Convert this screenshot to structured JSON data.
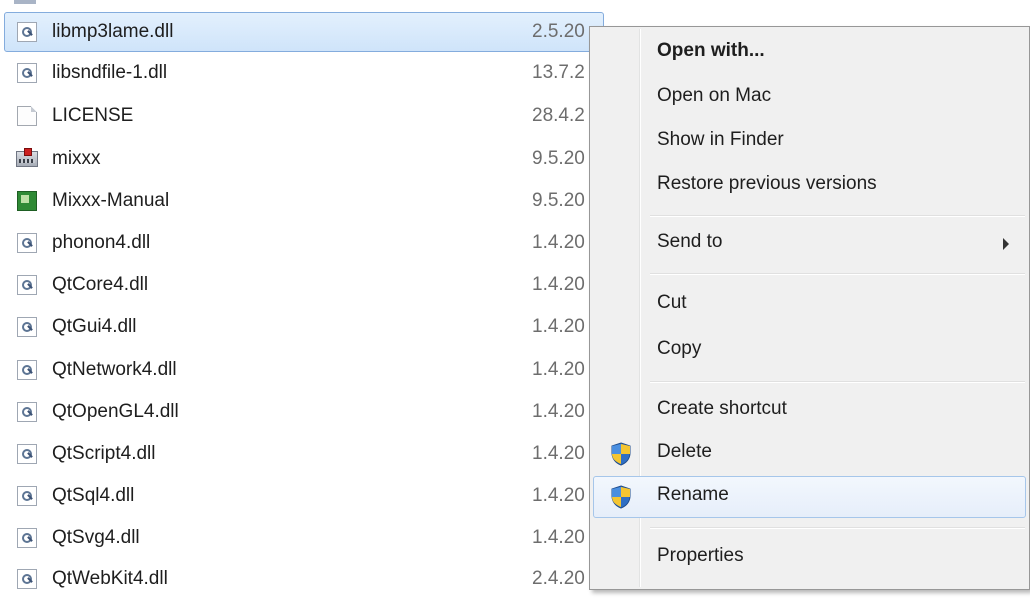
{
  "files": [
    {
      "name": "libmp3lame.dll",
      "date": "2.5.20",
      "icon": "dll-file-icon",
      "selected": true
    },
    {
      "name": "libsndfile-1.dll",
      "date": "13.7.2",
      "icon": "dll-file-icon"
    },
    {
      "name": "LICENSE",
      "date": "28.4.2",
      "icon": "text-file-icon"
    },
    {
      "name": "mixxx",
      "date": "9.5.20",
      "icon": "mixxx-app-icon"
    },
    {
      "name": "Mixxx-Manual",
      "date": "9.5.20",
      "icon": "help-document-icon"
    },
    {
      "name": "phonon4.dll",
      "date": "1.4.20",
      "icon": "dll-file-icon"
    },
    {
      "name": "QtCore4.dll",
      "date": "1.4.20",
      "icon": "dll-file-icon"
    },
    {
      "name": "QtGui4.dll",
      "date": "1.4.20",
      "icon": "dll-file-icon"
    },
    {
      "name": "QtNetwork4.dll",
      "date": "1.4.20",
      "icon": "dll-file-icon"
    },
    {
      "name": "QtOpenGL4.dll",
      "date": "1.4.20",
      "icon": "dll-file-icon"
    },
    {
      "name": "QtScript4.dll",
      "date": "1.4.20",
      "icon": "dll-file-icon"
    },
    {
      "name": "QtSql4.dll",
      "date": "1.4.20",
      "icon": "dll-file-icon"
    },
    {
      "name": "QtSvg4.dll",
      "date": "1.4.20",
      "icon": "dll-file-icon"
    },
    {
      "name": "QtWebKit4.dll",
      "date": "2.4.20",
      "icon": "dll-file-icon"
    }
  ],
  "context_menu": {
    "open_with": "Open with...",
    "open_on_mac": "Open on Mac",
    "show_in_finder": "Show in Finder",
    "restore_previous_versions": "Restore previous versions",
    "send_to": "Send to",
    "cut": "Cut",
    "copy": "Copy",
    "create_shortcut": "Create shortcut",
    "delete": "Delete",
    "rename": "Rename",
    "properties": "Properties",
    "hovered_item": "Rename",
    "shield_icon": "uac-shield-icon",
    "submenu_icon": "submenu-arrow-icon"
  },
  "colors": {
    "selection_border": "#84acdd",
    "menu_background": "#f0f0f0",
    "hover_border": "#a6c6ea"
  }
}
